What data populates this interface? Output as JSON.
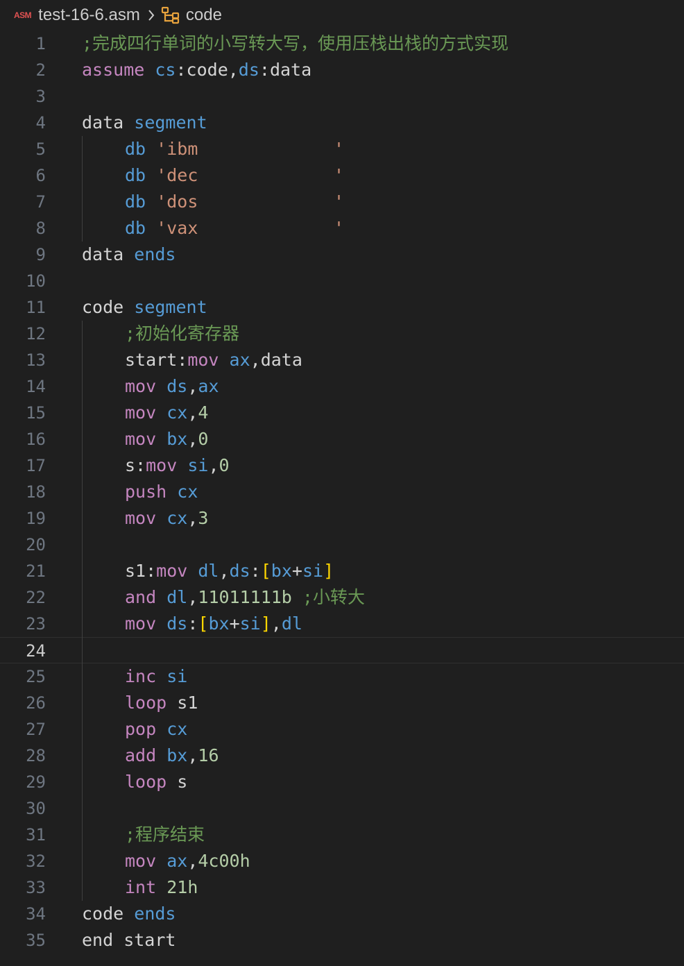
{
  "breadcrumb": {
    "file_badge": "ASM",
    "file_name": "test-16-6.asm",
    "symbol": "code"
  },
  "editor": {
    "current_line": 24,
    "lines": [
      {
        "n": "1",
        "indent": 0,
        "tokens": [
          {
            "t": ";完成四行单词的小写转大写，使用压栈出栈的方式实现",
            "c": "cmt"
          }
        ]
      },
      {
        "n": "2",
        "indent": 0,
        "tokens": [
          {
            "t": "assume",
            "c": "kw"
          },
          {
            "t": " ",
            "c": "pl"
          },
          {
            "t": "cs",
            "c": "reg"
          },
          {
            "t": ":code,",
            "c": "pl"
          },
          {
            "t": "ds",
            "c": "reg"
          },
          {
            "t": ":data",
            "c": "pl"
          }
        ]
      },
      {
        "n": "3",
        "indent": 0,
        "tokens": []
      },
      {
        "n": "4",
        "indent": 0,
        "tokens": [
          {
            "t": "data",
            "c": "id"
          },
          {
            "t": " ",
            "c": "pl"
          },
          {
            "t": "segment",
            "c": "reg"
          }
        ]
      },
      {
        "n": "5",
        "indent": 1,
        "tokens": [
          {
            "t": "db",
            "c": "reg"
          },
          {
            "t": " ",
            "c": "pl"
          },
          {
            "t": "'ibm             '",
            "c": "str"
          }
        ]
      },
      {
        "n": "6",
        "indent": 1,
        "tokens": [
          {
            "t": "db",
            "c": "reg"
          },
          {
            "t": " ",
            "c": "pl"
          },
          {
            "t": "'dec             '",
            "c": "str"
          }
        ]
      },
      {
        "n": "7",
        "indent": 1,
        "tokens": [
          {
            "t": "db",
            "c": "reg"
          },
          {
            "t": " ",
            "c": "pl"
          },
          {
            "t": "'dos             '",
            "c": "str"
          }
        ]
      },
      {
        "n": "8",
        "indent": 1,
        "tokens": [
          {
            "t": "db",
            "c": "reg"
          },
          {
            "t": " ",
            "c": "pl"
          },
          {
            "t": "'vax             '",
            "c": "str"
          }
        ]
      },
      {
        "n": "9",
        "indent": 0,
        "tokens": [
          {
            "t": "data",
            "c": "id"
          },
          {
            "t": " ",
            "c": "pl"
          },
          {
            "t": "ends",
            "c": "reg"
          }
        ]
      },
      {
        "n": "10",
        "indent": 0,
        "tokens": []
      },
      {
        "n": "11",
        "indent": 0,
        "tokens": [
          {
            "t": "code",
            "c": "id"
          },
          {
            "t": " ",
            "c": "pl"
          },
          {
            "t": "segment",
            "c": "reg"
          }
        ]
      },
      {
        "n": "12",
        "indent": 1,
        "tokens": [
          {
            "t": ";初始化寄存器",
            "c": "cmt"
          }
        ]
      },
      {
        "n": "13",
        "indent": 1,
        "tokens": [
          {
            "t": "start:",
            "c": "pl"
          },
          {
            "t": "mov",
            "c": "kw"
          },
          {
            "t": " ",
            "c": "pl"
          },
          {
            "t": "ax",
            "c": "reg"
          },
          {
            "t": ",data",
            "c": "pl"
          }
        ]
      },
      {
        "n": "14",
        "indent": 1,
        "tokens": [
          {
            "t": "mov",
            "c": "kw"
          },
          {
            "t": " ",
            "c": "pl"
          },
          {
            "t": "ds",
            "c": "reg"
          },
          {
            "t": ",",
            "c": "pl"
          },
          {
            "t": "ax",
            "c": "reg"
          }
        ]
      },
      {
        "n": "15",
        "indent": 1,
        "tokens": [
          {
            "t": "mov",
            "c": "kw"
          },
          {
            "t": " ",
            "c": "pl"
          },
          {
            "t": "cx",
            "c": "reg"
          },
          {
            "t": ",",
            "c": "pl"
          },
          {
            "t": "4",
            "c": "num"
          }
        ]
      },
      {
        "n": "16",
        "indent": 1,
        "tokens": [
          {
            "t": "mov",
            "c": "kw"
          },
          {
            "t": " ",
            "c": "pl"
          },
          {
            "t": "bx",
            "c": "reg"
          },
          {
            "t": ",",
            "c": "pl"
          },
          {
            "t": "0",
            "c": "num"
          }
        ]
      },
      {
        "n": "17",
        "indent": 1,
        "tokens": [
          {
            "t": "s:",
            "c": "pl"
          },
          {
            "t": "mov",
            "c": "kw"
          },
          {
            "t": " ",
            "c": "pl"
          },
          {
            "t": "si",
            "c": "reg"
          },
          {
            "t": ",",
            "c": "pl"
          },
          {
            "t": "0",
            "c": "num"
          }
        ]
      },
      {
        "n": "18",
        "indent": 1,
        "tokens": [
          {
            "t": "push",
            "c": "kw"
          },
          {
            "t": " ",
            "c": "pl"
          },
          {
            "t": "cx",
            "c": "reg"
          }
        ]
      },
      {
        "n": "19",
        "indent": 1,
        "tokens": [
          {
            "t": "mov",
            "c": "kw"
          },
          {
            "t": " ",
            "c": "pl"
          },
          {
            "t": "cx",
            "c": "reg"
          },
          {
            "t": ",",
            "c": "pl"
          },
          {
            "t": "3",
            "c": "num"
          }
        ]
      },
      {
        "n": "20",
        "indent": 1,
        "tokens": []
      },
      {
        "n": "21",
        "indent": 1,
        "tokens": [
          {
            "t": "s1:",
            "c": "pl"
          },
          {
            "t": "mov",
            "c": "kw"
          },
          {
            "t": " ",
            "c": "pl"
          },
          {
            "t": "dl",
            "c": "reg"
          },
          {
            "t": ",",
            "c": "pl"
          },
          {
            "t": "ds",
            "c": "reg"
          },
          {
            "t": ":",
            "c": "pl"
          },
          {
            "t": "[",
            "c": "brk"
          },
          {
            "t": "bx",
            "c": "reg"
          },
          {
            "t": "+",
            "c": "pl"
          },
          {
            "t": "si",
            "c": "reg"
          },
          {
            "t": "]",
            "c": "brk"
          }
        ]
      },
      {
        "n": "22",
        "indent": 1,
        "tokens": [
          {
            "t": "and",
            "c": "kw"
          },
          {
            "t": " ",
            "c": "pl"
          },
          {
            "t": "dl",
            "c": "reg"
          },
          {
            "t": ",",
            "c": "pl"
          },
          {
            "t": "11011111b",
            "c": "num"
          },
          {
            "t": " ",
            "c": "pl"
          },
          {
            "t": ";小转大",
            "c": "cmt"
          }
        ]
      },
      {
        "n": "23",
        "indent": 1,
        "tokens": [
          {
            "t": "mov",
            "c": "kw"
          },
          {
            "t": " ",
            "c": "pl"
          },
          {
            "t": "ds",
            "c": "reg"
          },
          {
            "t": ":",
            "c": "pl"
          },
          {
            "t": "[",
            "c": "brk"
          },
          {
            "t": "bx",
            "c": "reg"
          },
          {
            "t": "+",
            "c": "pl"
          },
          {
            "t": "si",
            "c": "reg"
          },
          {
            "t": "]",
            "c": "brk"
          },
          {
            "t": ",",
            "c": "pl"
          },
          {
            "t": "dl",
            "c": "reg"
          }
        ]
      },
      {
        "n": "24",
        "indent": 1,
        "tokens": []
      },
      {
        "n": "25",
        "indent": 1,
        "tokens": [
          {
            "t": "inc",
            "c": "kw"
          },
          {
            "t": " ",
            "c": "pl"
          },
          {
            "t": "si",
            "c": "reg"
          }
        ]
      },
      {
        "n": "26",
        "indent": 1,
        "tokens": [
          {
            "t": "loop",
            "c": "kw"
          },
          {
            "t": " s1",
            "c": "pl"
          }
        ]
      },
      {
        "n": "27",
        "indent": 1,
        "tokens": [
          {
            "t": "pop",
            "c": "kw"
          },
          {
            "t": " ",
            "c": "pl"
          },
          {
            "t": "cx",
            "c": "reg"
          }
        ]
      },
      {
        "n": "28",
        "indent": 1,
        "tokens": [
          {
            "t": "add",
            "c": "kw"
          },
          {
            "t": " ",
            "c": "pl"
          },
          {
            "t": "bx",
            "c": "reg"
          },
          {
            "t": ",",
            "c": "pl"
          },
          {
            "t": "16",
            "c": "num"
          }
        ]
      },
      {
        "n": "29",
        "indent": 1,
        "tokens": [
          {
            "t": "loop",
            "c": "kw"
          },
          {
            "t": " s",
            "c": "pl"
          }
        ]
      },
      {
        "n": "30",
        "indent": 1,
        "tokens": []
      },
      {
        "n": "31",
        "indent": 1,
        "tokens": [
          {
            "t": ";程序结束",
            "c": "cmt"
          }
        ]
      },
      {
        "n": "32",
        "indent": 1,
        "tokens": [
          {
            "t": "mov",
            "c": "kw"
          },
          {
            "t": " ",
            "c": "pl"
          },
          {
            "t": "ax",
            "c": "reg"
          },
          {
            "t": ",",
            "c": "pl"
          },
          {
            "t": "4c00h",
            "c": "num"
          }
        ]
      },
      {
        "n": "33",
        "indent": 1,
        "tokens": [
          {
            "t": "int",
            "c": "kw"
          },
          {
            "t": " ",
            "c": "pl"
          },
          {
            "t": "21h",
            "c": "num"
          }
        ]
      },
      {
        "n": "34",
        "indent": 0,
        "tokens": [
          {
            "t": "code",
            "c": "id"
          },
          {
            "t": " ",
            "c": "pl"
          },
          {
            "t": "ends",
            "c": "reg"
          }
        ]
      },
      {
        "n": "35",
        "indent": 0,
        "tokens": [
          {
            "t": "end start",
            "c": "pl"
          }
        ]
      }
    ]
  }
}
